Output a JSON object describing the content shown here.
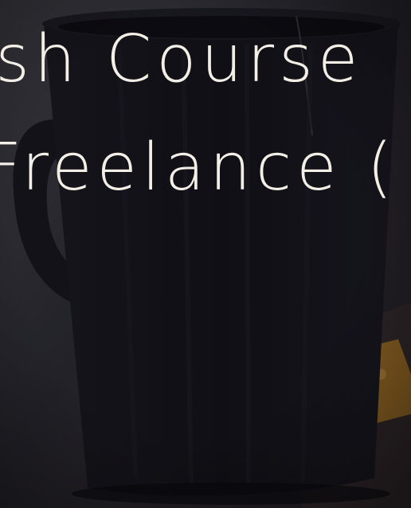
{
  "hero": {
    "headline_line_1": "ash Course",
    "headline_line_2": "Freelance (",
    "background_image": "coffee-mug-photo"
  },
  "colors": {
    "text": "#f3efe7",
    "mug": "#13121a",
    "background": "#2b2a31"
  }
}
